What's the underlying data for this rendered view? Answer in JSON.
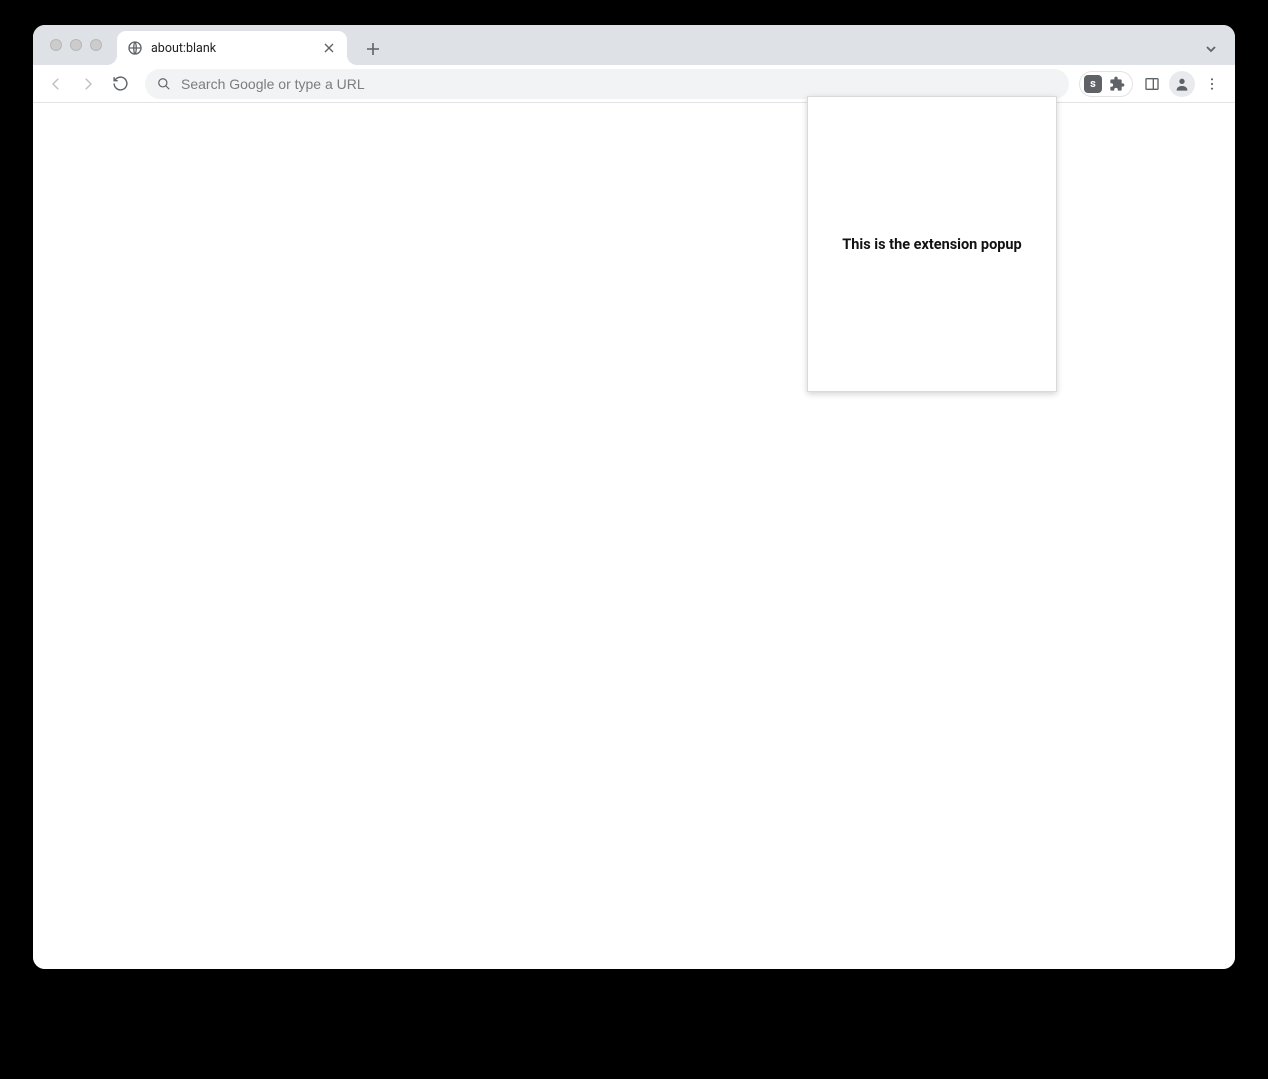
{
  "tab": {
    "title": "about:blank"
  },
  "omnibox": {
    "placeholder": "Search Google or type a URL",
    "value": ""
  },
  "extension": {
    "badge_letter": "s"
  },
  "popup": {
    "text": "This is the extension popup"
  }
}
